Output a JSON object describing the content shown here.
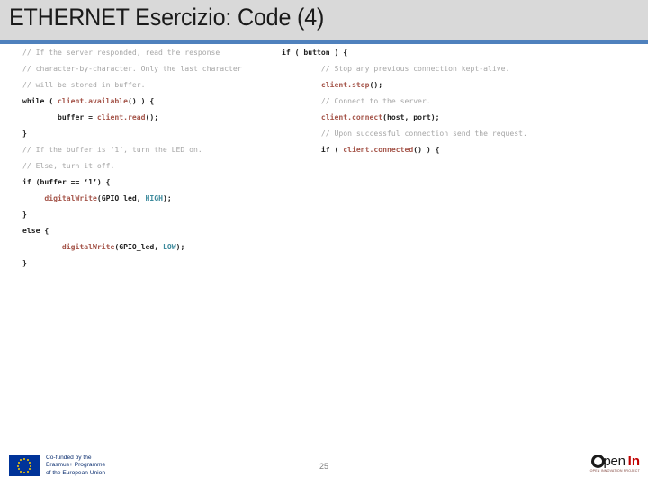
{
  "header": {
    "title": "ETHERNET Esercizio: Code (4)",
    "background_color": "#d9d9d9",
    "rule_color": "#4f81bd"
  },
  "code": {
    "syntax_colors": {
      "comment": "#a6a6a6",
      "keyword": "#1f1f1f",
      "function": "#a5554a",
      "constant": "#3c8a9c"
    },
    "left_column": [
      {
        "indent": 0,
        "tokens": [
          {
            "t": "// If the server responded, read the response",
            "c": "com"
          }
        ]
      },
      {
        "indent": 0,
        "tokens": [
          {
            "t": "// character-by-character. Only the last character",
            "c": "com"
          }
        ]
      },
      {
        "indent": 0,
        "tokens": [
          {
            "t": "// will be stored in buffer.",
            "c": "com"
          }
        ]
      },
      {
        "indent": 0,
        "tokens": [
          {
            "t": "while ( ",
            "c": "key"
          },
          {
            "t": "client.available",
            "c": "fn"
          },
          {
            "t": "() ) {",
            "c": "plain"
          }
        ]
      },
      {
        "indent": 8,
        "tokens": [
          {
            "t": "buffer = ",
            "c": "plain"
          },
          {
            "t": "client.read",
            "c": "fn"
          },
          {
            "t": "();",
            "c": "plain"
          }
        ]
      },
      {
        "indent": 0,
        "tokens": [
          {
            "t": "}",
            "c": "plain"
          }
        ]
      },
      {
        "indent": 0,
        "tokens": [
          {
            "t": "// If the buffer is ‘1’, turn the LED on.",
            "c": "com"
          }
        ]
      },
      {
        "indent": 0,
        "tokens": [
          {
            "t": "// Else, turn it off.",
            "c": "com"
          }
        ]
      },
      {
        "indent": 0,
        "tokens": [
          {
            "t": "if (buffer == ‘1’) {",
            "c": "plain"
          }
        ]
      },
      {
        "indent": 5,
        "tokens": [
          {
            "t": "digitalWrite",
            "c": "fn"
          },
          {
            "t": "(GPIO_led, ",
            "c": "plain"
          },
          {
            "t": "HIGH",
            "c": "const"
          },
          {
            "t": ");",
            "c": "plain"
          }
        ]
      },
      {
        "indent": 0,
        "tokens": [
          {
            "t": "}",
            "c": "plain"
          }
        ]
      },
      {
        "indent": 0,
        "tokens": [
          {
            "t": "else {",
            "c": "plain"
          }
        ]
      },
      {
        "indent": 9,
        "tokens": [
          {
            "t": "digitalWrite",
            "c": "fn"
          },
          {
            "t": "(GPIO_led, ",
            "c": "plain"
          },
          {
            "t": "LOW",
            "c": "const"
          },
          {
            "t": ");",
            "c": "plain"
          }
        ]
      },
      {
        "indent": 0,
        "tokens": [
          {
            "t": "}",
            "c": "plain"
          }
        ]
      }
    ],
    "right_column": [
      {
        "indent": 0,
        "tokens": [
          {
            "t": "if ( button ) {",
            "c": "key"
          }
        ]
      },
      {
        "indent": 9,
        "tokens": [
          {
            "t": "// Stop any previous connection kept-alive.",
            "c": "com"
          }
        ]
      },
      {
        "indent": 9,
        "tokens": [
          {
            "t": "client.stop",
            "c": "fn"
          },
          {
            "t": "();",
            "c": "plain"
          }
        ]
      },
      {
        "indent": 9,
        "tokens": [
          {
            "t": "// Connect to the server.",
            "c": "com"
          }
        ]
      },
      {
        "indent": 9,
        "tokens": [
          {
            "t": "client.connect",
            "c": "fn"
          },
          {
            "t": "(host, port);",
            "c": "plain"
          }
        ]
      },
      {
        "indent": 9,
        "tokens": [
          {
            "t": "// Upon successful connection send the request.",
            "c": "com"
          }
        ]
      },
      {
        "indent": 9,
        "tokens": [
          {
            "t": "if ( ",
            "c": "plain"
          },
          {
            "t": "client.connected",
            "c": "fn"
          },
          {
            "t": "() ) {",
            "c": "plain"
          }
        ]
      }
    ]
  },
  "footer": {
    "erasmus_text": "Co-funded by the\nErasmus+ Programme\nof the European Union",
    "page_number": "25",
    "openin": {
      "o": "O",
      "pen": "pen",
      "in": "In",
      "tagline": "OPEN INNOVATION PROJECT"
    }
  }
}
